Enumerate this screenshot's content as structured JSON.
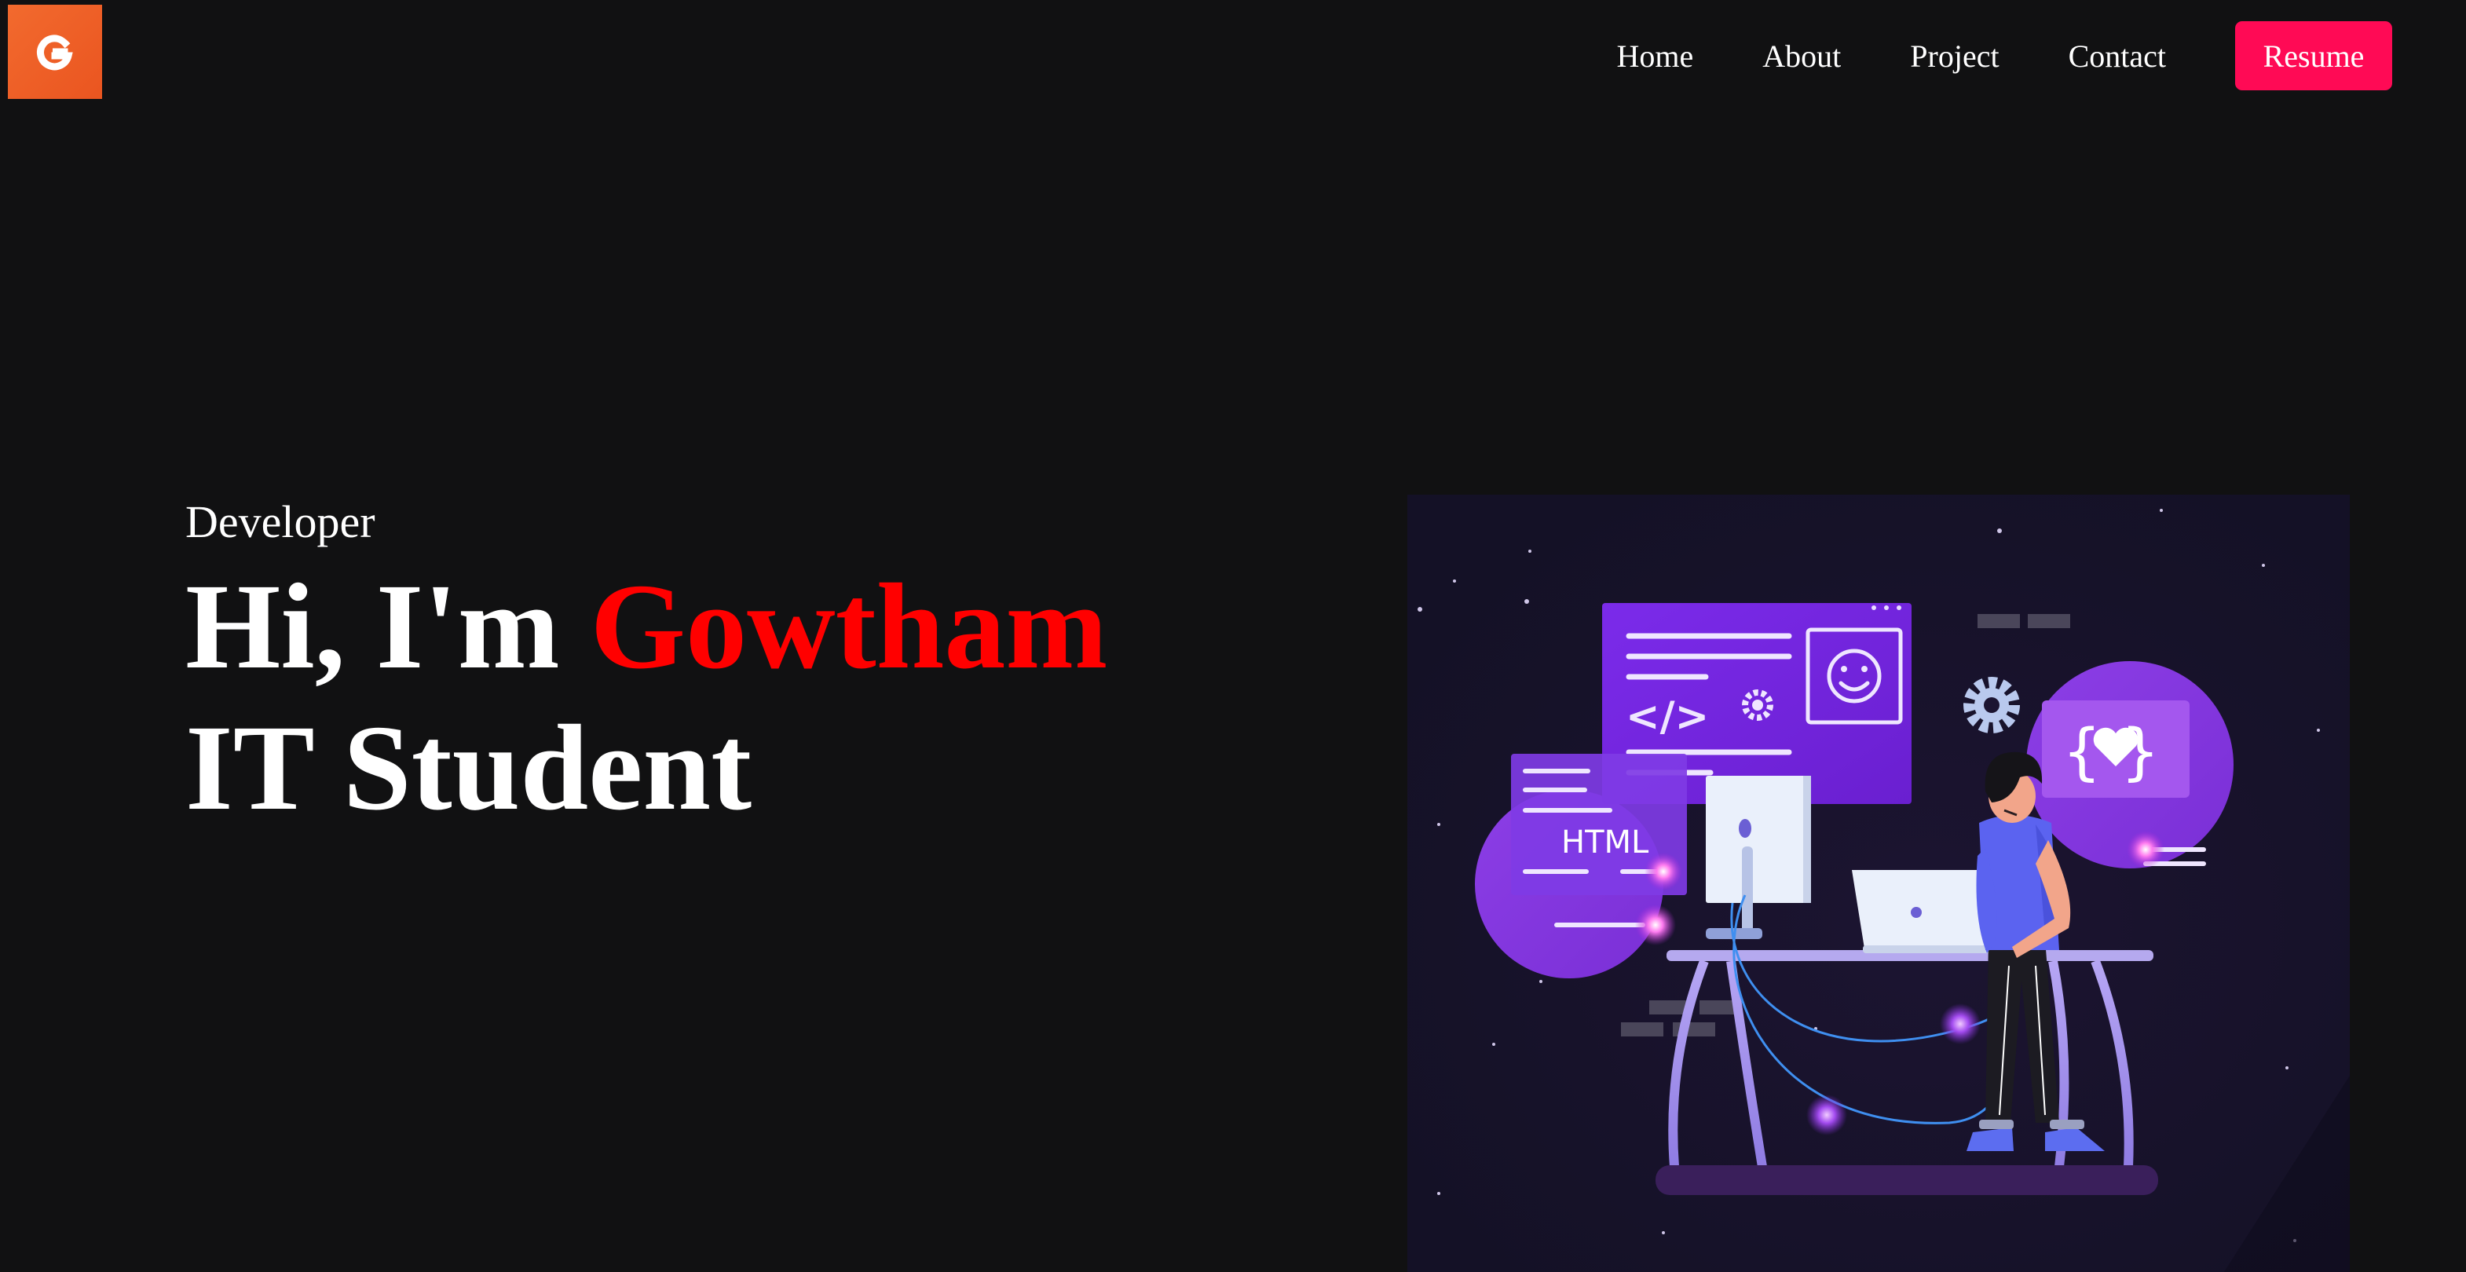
{
  "brand": {
    "logo_letter": "G",
    "logo_color": "#ef5f25"
  },
  "nav": {
    "links": [
      "Home",
      "About",
      "Project",
      "Contact"
    ],
    "resume_label": "Resume",
    "resume_color": "#ff0a55"
  },
  "hero": {
    "kicker": "Developer",
    "greeting": "Hi, I'm",
    "name": "Gowtham",
    "name_color": "#ff0000",
    "role": "IT Student"
  },
  "illustration": {
    "code_tag_text": "</>",
    "html_label": "HTML",
    "braces_text": "{ }",
    "icons": [
      "gear-icon",
      "smiley-icon",
      "heart-icon"
    ]
  }
}
